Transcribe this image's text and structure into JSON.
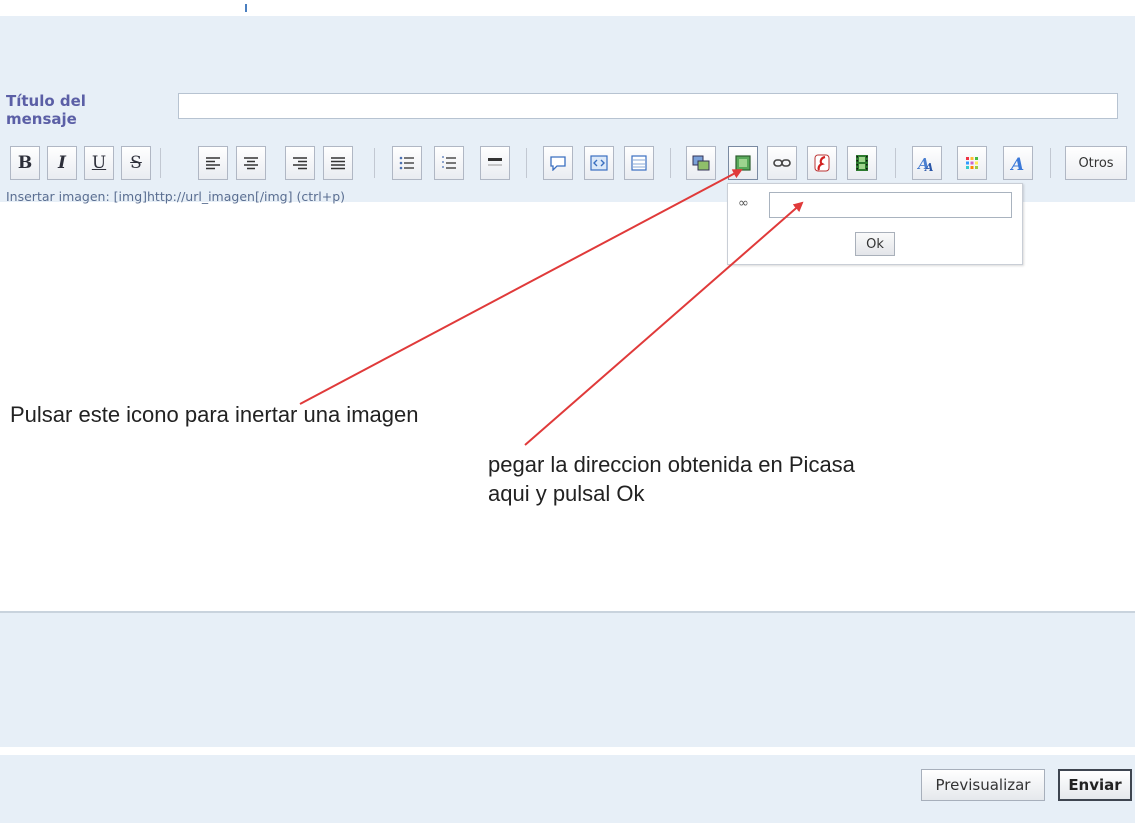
{
  "form": {
    "title_label": "Título del\nmensaje",
    "title_value": ""
  },
  "toolbar": {
    "bold": "B",
    "italic": "I",
    "underline": "U",
    "strike": "S",
    "otros": "Otros",
    "hint": "Insertar imagen: [img]http://url_imagen[/img] (ctrl+p)"
  },
  "popup": {
    "url_value": "",
    "ok_label": "Ok",
    "link_glyph": "∞"
  },
  "annotations": {
    "click_icon": "Pulsar este icono para inertar una imagen",
    "paste_url": "pegar la direccion obtenida en Picasa\naqui y pulsal Ok",
    "arrow_color": "#e03a3a"
  },
  "actions": {
    "preview": "Previsualizar",
    "send": "Enviar"
  }
}
